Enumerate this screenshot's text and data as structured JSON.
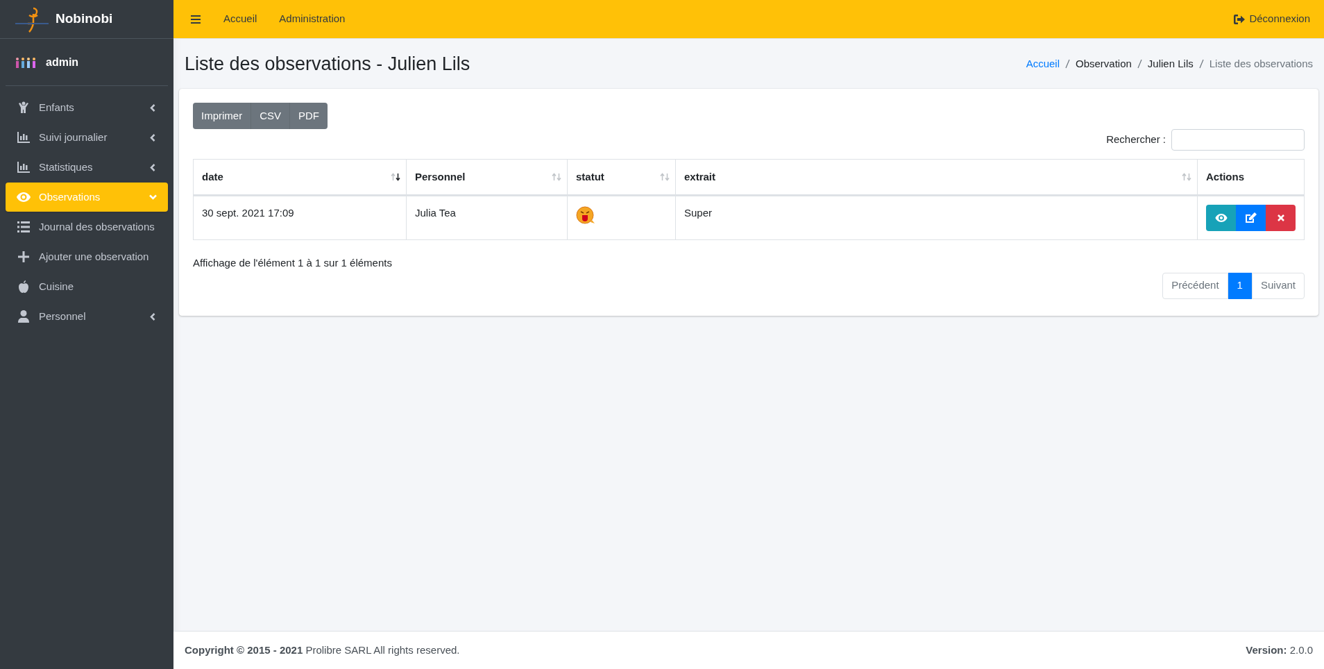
{
  "brand": {
    "name": "Nobinobi"
  },
  "user": {
    "name": "admin"
  },
  "sidebar": {
    "items": [
      {
        "label": "Enfants",
        "selected": false,
        "expanded": false
      },
      {
        "label": "Suivi journalier",
        "selected": false,
        "expanded": false
      },
      {
        "label": "Statistiques",
        "selected": false,
        "expanded": false
      },
      {
        "label": "Observations",
        "selected": true,
        "expanded": true,
        "children": [
          {
            "label": "Journal des observations",
            "selected": false
          },
          {
            "label": "Ajouter une observation",
            "selected": false
          }
        ]
      },
      {
        "label": "Cuisine",
        "selected": false
      },
      {
        "label": "Personnel",
        "selected": false,
        "expanded": false
      }
    ]
  },
  "topbar": {
    "links": [
      "Accueil",
      "Administration"
    ],
    "logout": "Déconnexion"
  },
  "page": {
    "title": "Liste des observations - Julien Lils",
    "breadcrumb": [
      {
        "label": "Accueil",
        "kind": "link"
      },
      {
        "label": "Observation",
        "kind": "text"
      },
      {
        "label": "Julien Lils",
        "kind": "text"
      },
      {
        "label": "Liste des observations",
        "kind": "active"
      }
    ]
  },
  "export_buttons": [
    "Imprimer",
    "CSV",
    "PDF"
  ],
  "search": {
    "label": "Rechercher :"
  },
  "table": {
    "columns": [
      {
        "label": "date",
        "sortable": true,
        "sorted": true
      },
      {
        "label": "Personnel",
        "sortable": true,
        "sorted": false
      },
      {
        "label": "statut",
        "sortable": true,
        "sorted": false
      },
      {
        "label": "extrait",
        "sortable": true,
        "sorted": false
      },
      {
        "label": "Actions",
        "sortable": false
      }
    ],
    "rows": [
      {
        "date": "30 sept. 2021 17:09",
        "personnel": "Julia Tea",
        "extrait": "Super"
      }
    ]
  },
  "info": "Affichage de l'élément 1 à 1 sur 1 éléments",
  "pagination": [
    {
      "label": "Précédent",
      "selected": false
    },
    {
      "label": "1",
      "selected": true
    },
    {
      "label": "Suivant",
      "selected": false
    }
  ],
  "footer": {
    "copyright": "**Copyright © 2015 - 2021** Prolibre SARL All rights reserved.",
    "version": "**Version:** 2.0.0"
  }
}
